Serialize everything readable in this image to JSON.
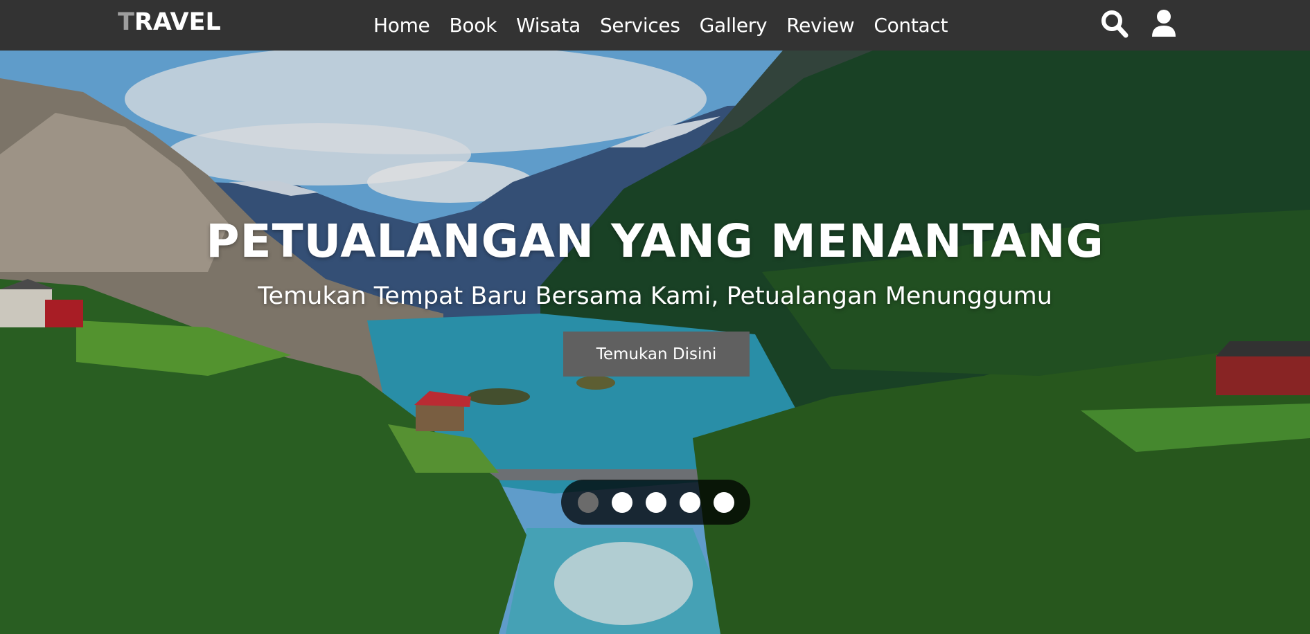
{
  "brand": {
    "first": "T",
    "rest": "RAVEL"
  },
  "nav": {
    "links": [
      "Home",
      "Book",
      "Wisata",
      "Services",
      "Gallery",
      "Review",
      "Contact"
    ],
    "icons": [
      "search-icon",
      "user-icon"
    ]
  },
  "hero": {
    "title": "PETUALANGAN YANG MENANTANG",
    "subtitle": "Temukan Tempat Baru Bersama Kami, Petualangan Menunggumu",
    "cta_label": "Temukan Disini",
    "slides_count": 5,
    "active_slide": 1
  },
  "colors": {
    "navbar": "#333333",
    "button": "#606060",
    "dot_active": "#6b6b6b",
    "dot": "#ffffff"
  }
}
